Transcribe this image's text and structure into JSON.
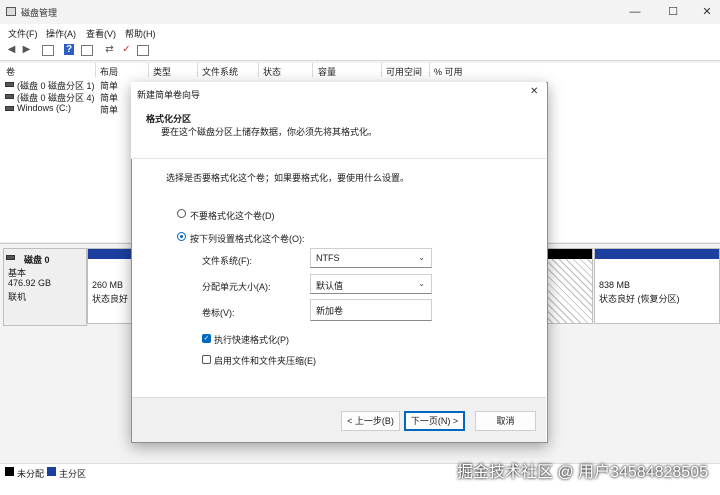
{
  "window": {
    "title": "磁盘管理",
    "minimize": "—",
    "maximize": "☐",
    "close": "✕"
  },
  "menu": [
    "文件(F)",
    "操作(A)",
    "查看(V)",
    "帮助(H)"
  ],
  "columns": [
    "卷",
    "布局",
    "类型",
    "文件系统",
    "状态",
    "容量",
    "可用空间",
    "% 可用"
  ],
  "volumes": [
    {
      "name": "(磁盘 0 磁盘分区 1)",
      "layout": "简单"
    },
    {
      "name": "(磁盘 0 磁盘分区 4)",
      "layout": "简单"
    },
    {
      "name": "Windows (C:)",
      "layout": "简单"
    }
  ],
  "disk": {
    "name": "磁盘 0",
    "type": "基本",
    "size": "476.92 GB",
    "state": "联机",
    "partitions": [
      {
        "size": "260 MB",
        "status": "状态良好"
      },
      {
        "size": "838 MB",
        "status": "状态良好 (恢复分区)"
      }
    ]
  },
  "legend": [
    "未分配",
    "主分区"
  ],
  "wizard": {
    "title": "新建简单卷向导",
    "heading": "格式化分区",
    "subheading": "要在这个磁盘分区上储存数据，你必须先将其格式化。",
    "prompt": "选择是否要格式化这个卷；如果要格式化，要使用什么设置。",
    "radio_noformat": "不要格式化这个卷(D)",
    "radio_format": "按下列设置格式化这个卷(O):",
    "fs_label": "文件系统(F):",
    "fs_value": "NTFS",
    "alloc_label": "分配单元大小(A):",
    "alloc_value": "默认值",
    "vol_label": "卷标(V):",
    "vol_value": "新加卷",
    "quick_format": "执行快速格式化(P)",
    "compression": "启用文件和文件夹压缩(E)",
    "back": "< 上一步(B)",
    "next": "下一页(N) >",
    "cancel": "取消"
  },
  "watermark": "掘金技术社区 @ 用户34584828505"
}
